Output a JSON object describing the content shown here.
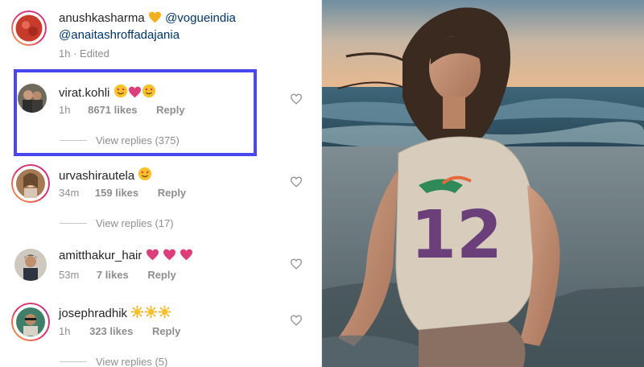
{
  "post": {
    "author": "anushkasharma",
    "mention_1": "@vogueindia",
    "mention_2": "@anaitashroffadajania",
    "time": "1h",
    "edited": "Edited"
  },
  "comments": [
    {
      "user": "virat.kohli",
      "emojis": "heart-eyes, heart, heart-eyes",
      "time": "1h",
      "likes": "8671 likes",
      "reply": "Reply",
      "view_replies": "View replies (375)"
    },
    {
      "user": "urvashirautela",
      "emojis": "heart-eyes",
      "time": "34m",
      "likes": "159 likes",
      "reply": "Reply",
      "view_replies": "View replies (17)"
    },
    {
      "user": "amitthakur_hair",
      "emojis": "pink hearts x3",
      "time": "53m",
      "likes": "7 likes",
      "reply": "Reply"
    },
    {
      "user": "josephradhik",
      "emojis": "suns x3",
      "time": "1h",
      "likes": "323 likes",
      "reply": "Reply",
      "view_replies": "View replies (5)"
    }
  ],
  "photo": {
    "shirt_number": "12"
  },
  "colors": {
    "highlight": "#4848ee",
    "text": "#262626",
    "muted": "#8e8e8e",
    "mention": "#003569"
  }
}
